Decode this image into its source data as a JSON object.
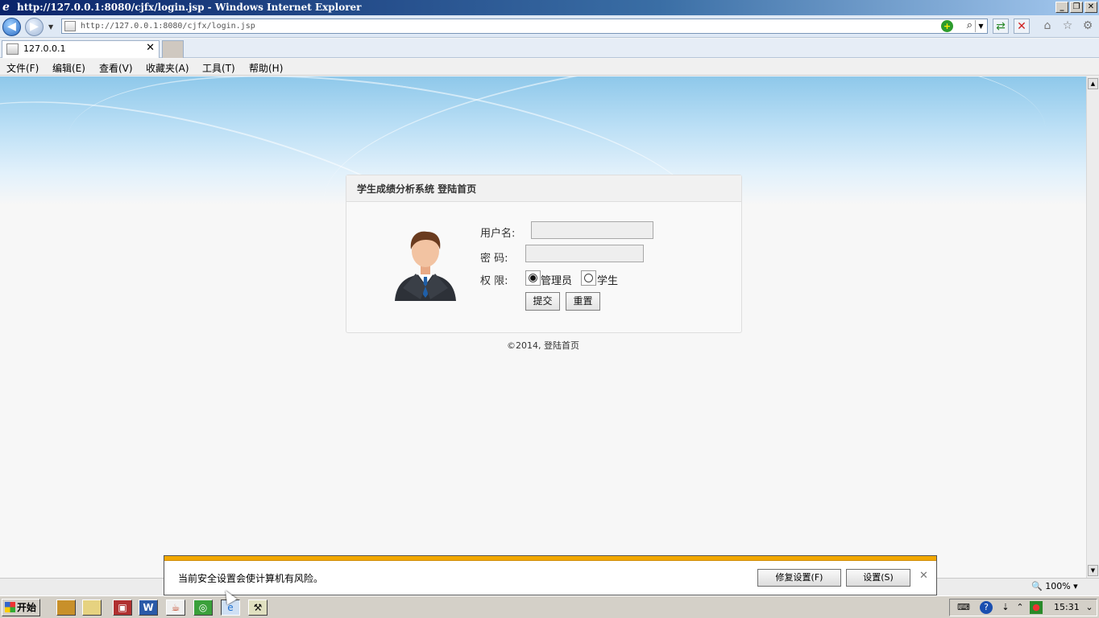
{
  "window": {
    "title": "http://127.0.0.1:8080/cjfx/login.jsp - Windows Internet Explorer",
    "minimize": "_",
    "restore": "❐",
    "close": "✕"
  },
  "address_bar": {
    "url": "http://127.0.0.1:8080/cjfx/login.jsp"
  },
  "tabs": [
    {
      "label": "127.0.0.1",
      "close": "✕"
    }
  ],
  "menu": [
    "文件(F)",
    "编辑(E)",
    "查看(V)",
    "收藏夹(A)",
    "工具(T)",
    "帮助(H)"
  ],
  "login": {
    "title": "学生成绩分析系统  登陆首页",
    "username_label": "用户名:",
    "username_value": "",
    "password_label": "密  码:",
    "password_value": "",
    "role_label": "权  限:",
    "roles": [
      {
        "label": "管理员",
        "checked": true
      },
      {
        "label": "学生",
        "checked": false
      }
    ],
    "submit": "提交",
    "reset": "重置",
    "footer": "©2014, 登陆首页"
  },
  "statusbar": {
    "zoom": "100%"
  },
  "notification": {
    "message": "当前安全设置会使计算机有风险。",
    "fix_button": "修复设置(F)",
    "settings_button": "设置(S)",
    "close": "✕"
  },
  "taskbar": {
    "start": "开始",
    "clock": "15:31"
  },
  "colors": {
    "titlebar": "#0a246a",
    "notification_accent": "#f2a800",
    "banner_blue": "#8ec8ea"
  }
}
